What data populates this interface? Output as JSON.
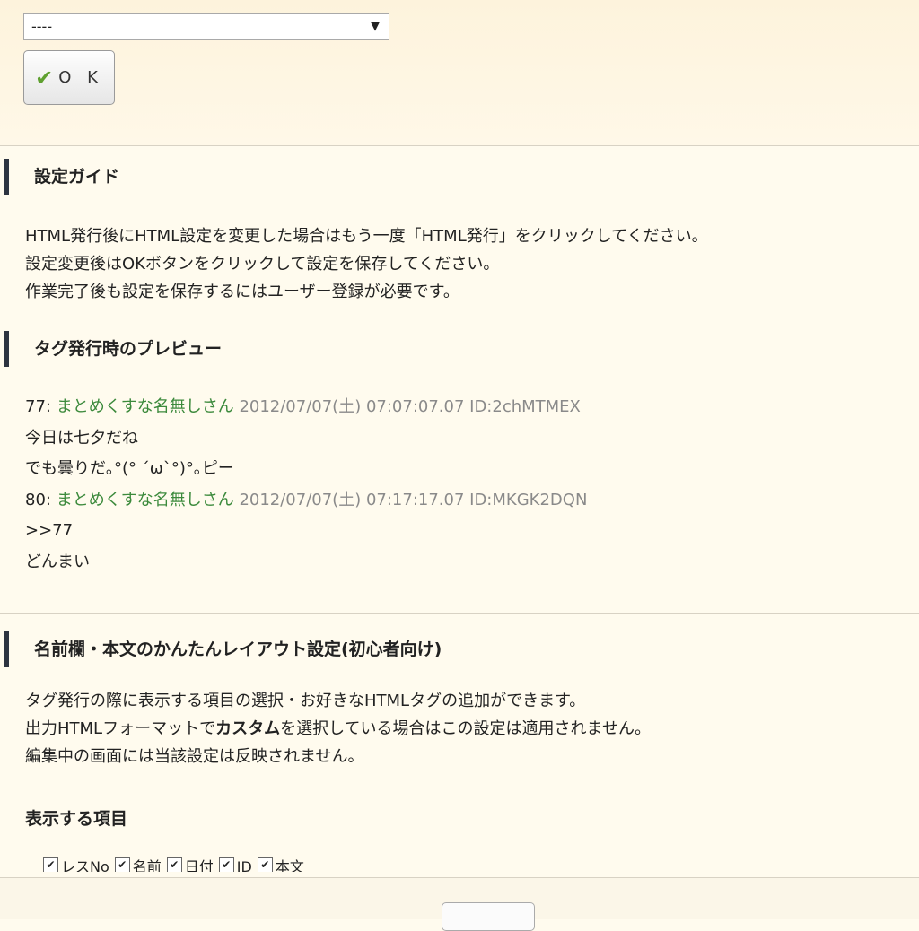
{
  "top": {
    "select_value": "----",
    "ok_label": "O K"
  },
  "guide": {
    "heading": "設定ガイド",
    "lines": [
      "HTML発行後にHTML設定を変更した場合はもう一度「HTML発行」をクリックしてください。",
      "設定変更後はOKボタンをクリックして設定を保存してください。",
      "作業完了後も設定を保存するにはユーザー登録が必要です。"
    ]
  },
  "preview": {
    "heading": "タグ発行時のプレビュー",
    "posts": [
      {
        "number": "77:",
        "name": "まとめくすな名無しさん",
        "meta": "2012/07/07(土) 07:07:07.07 ID:2chMTMEX",
        "body": [
          "今日は七夕だね",
          "でも曇りだ｡°(° ´ω`°)°｡ピー"
        ]
      },
      {
        "number": "80:",
        "name": "まとめくすな名無しさん",
        "meta": "2012/07/07(土) 07:17:17.07 ID:MKGK2DQN",
        "body": [
          ">>77",
          "どんまい"
        ]
      }
    ]
  },
  "layout": {
    "heading": "名前欄・本文のかんたんレイアウト設定(初心者向け)",
    "line1": "タグ発行の際に表示する項目の選択・お好きなHTMLタグの追加ができます。",
    "line2_before": "出力HTMLフォーマットで",
    "line2_bold": "カスタム",
    "line2_after": "を選択している場合はこの設定は適用されません。",
    "line3": "編集中の画面には当該設定は反映されません。",
    "display_items_heading": "表示する項目",
    "checkboxes": [
      "レスNo",
      "名前",
      "日付",
      "ID",
      "本文"
    ]
  }
}
